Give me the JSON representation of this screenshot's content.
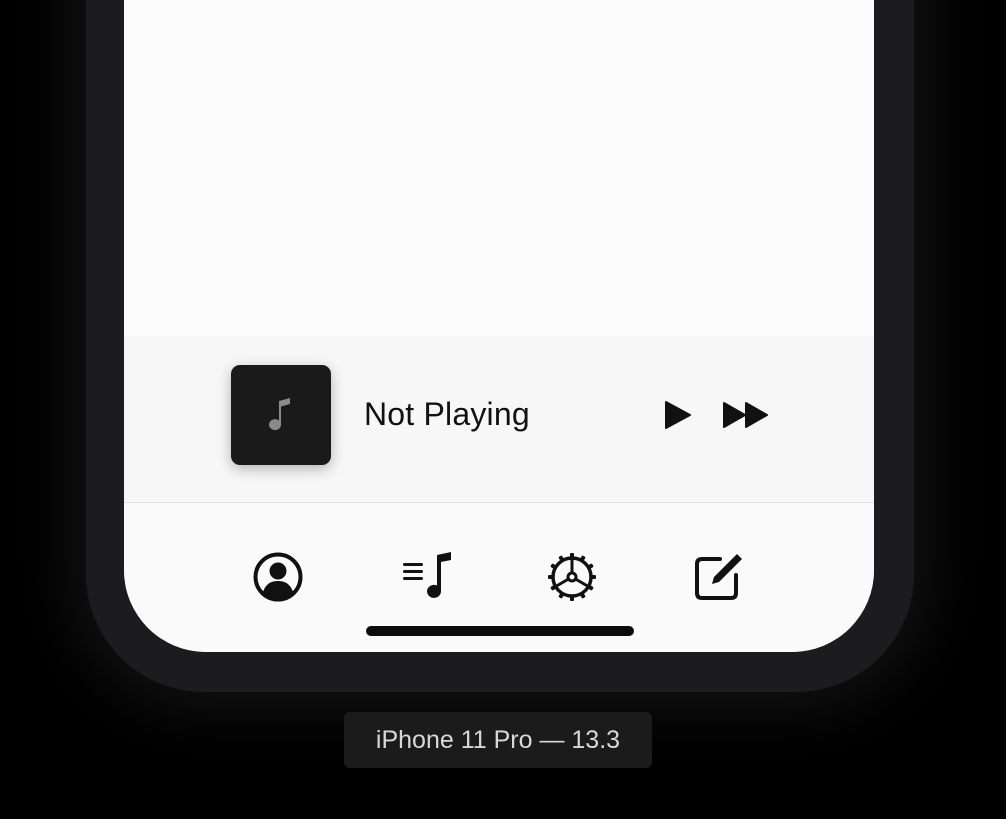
{
  "simulator": {
    "device_label": "iPhone 11 Pro — 13.3"
  },
  "mini_player": {
    "title": "Not Playing",
    "artwork_icon": "music-note-icon",
    "controls": [
      {
        "name": "play",
        "icon": "play-icon"
      },
      {
        "name": "fast-forward",
        "icon": "fast-forward-icon"
      }
    ]
  },
  "tab_bar": {
    "items": [
      {
        "name": "profile",
        "icon": "person-circle-icon"
      },
      {
        "name": "music",
        "icon": "music-list-icon"
      },
      {
        "name": "settings",
        "icon": "gear-icon"
      },
      {
        "name": "compose",
        "icon": "compose-icon"
      }
    ]
  },
  "colors": {
    "background": "#000000",
    "bezel": "#1c1c1e",
    "screen": "#fcfcfc",
    "artwork": "#1a1a1a",
    "icon": "#111111"
  }
}
